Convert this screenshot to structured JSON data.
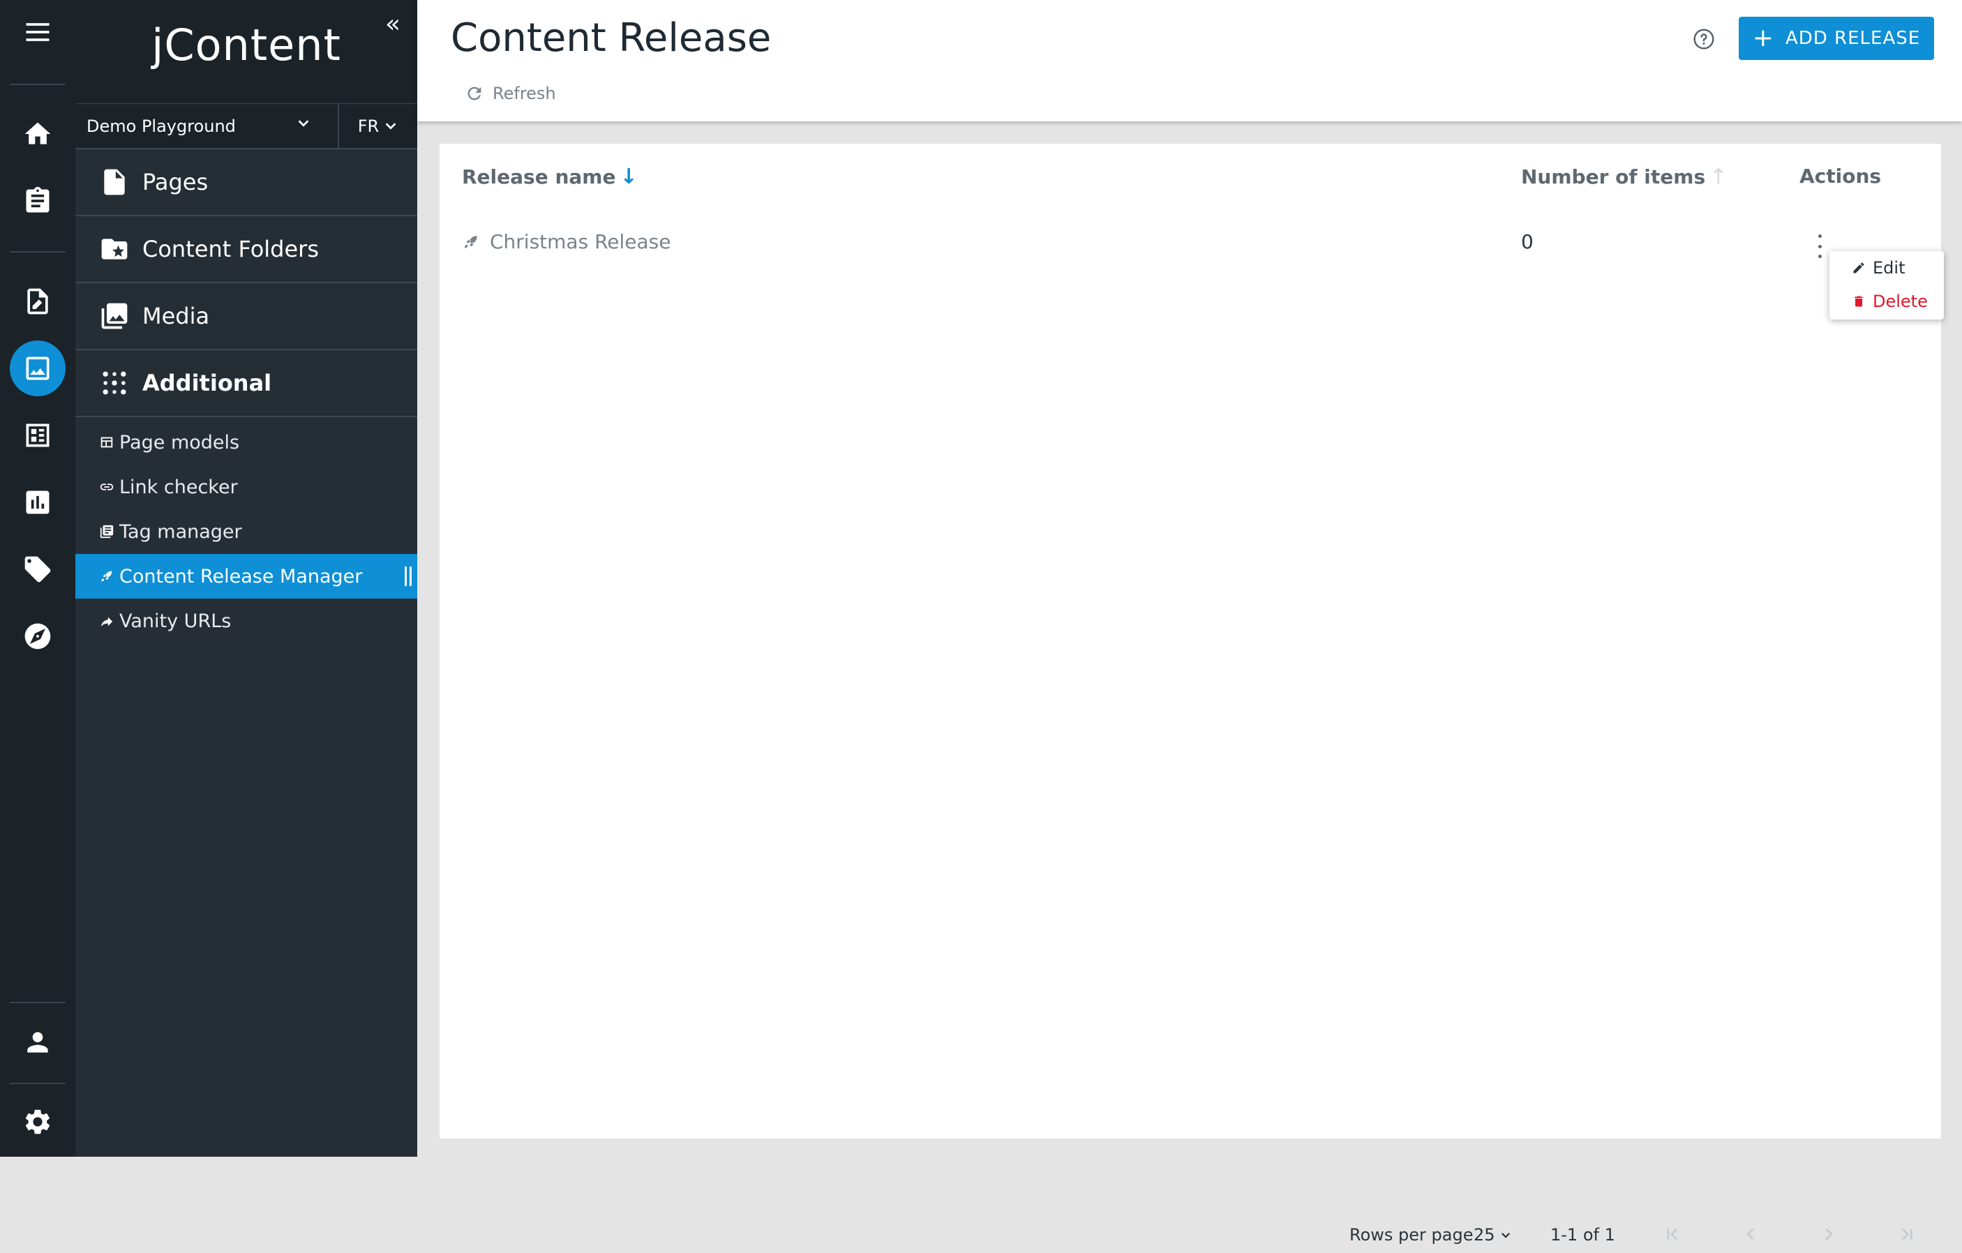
{
  "nav": {
    "logo": "jContent",
    "collapse_icon": "double-chevron-left-icon",
    "site": "Demo Playground",
    "language": "FR",
    "accordions": [
      {
        "label": "Pages",
        "icon": "page-icon"
      },
      {
        "label": "Content Folders",
        "icon": "folder-star-icon"
      },
      {
        "label": "Media",
        "icon": "image-icon"
      },
      {
        "label": "Additional",
        "icon": "apps-dots-icon"
      }
    ],
    "additional_items": [
      {
        "label": "Page models",
        "icon": "template-icon"
      },
      {
        "label": "Link checker",
        "icon": "link-icon"
      },
      {
        "label": "Tag manager",
        "icon": "tags-stack-icon"
      },
      {
        "label": "Content Release Manager",
        "icon": "rocket-icon"
      },
      {
        "label": "Vanity URLs",
        "icon": "arrow-forward-icon"
      }
    ]
  },
  "rail": {
    "items": [
      "menu-icon",
      "home-icon",
      "clipboard-icon",
      "edit-page-icon",
      "media-icon",
      "dashboard-icon",
      "chart-icon",
      "tag-icon",
      "compass-icon",
      "user-icon",
      "settings-icon"
    ]
  },
  "header": {
    "title": "Content Release",
    "refresh_label": "Refresh",
    "add_button_label": "ADD RELEASE",
    "add_button_icon": "+"
  },
  "table": {
    "columns": {
      "name": "Release name",
      "name_sort": "↓",
      "count": "Number of items",
      "count_sort": "↑",
      "actions": "Actions"
    },
    "rows": [
      {
        "name": "Christmas Release",
        "items": "0"
      }
    ]
  },
  "context_menu": {
    "edit": "Edit",
    "delete": "Delete"
  },
  "pagination": {
    "rows_per_page_label": "Rows per page",
    "rows_per_page": "25",
    "range": "1-1 of 1"
  },
  "colors": {
    "accent": "#0e8fd6",
    "rail_bg": "#1b2228",
    "nav_bg": "#262e35",
    "delete": "#e0182d"
  }
}
